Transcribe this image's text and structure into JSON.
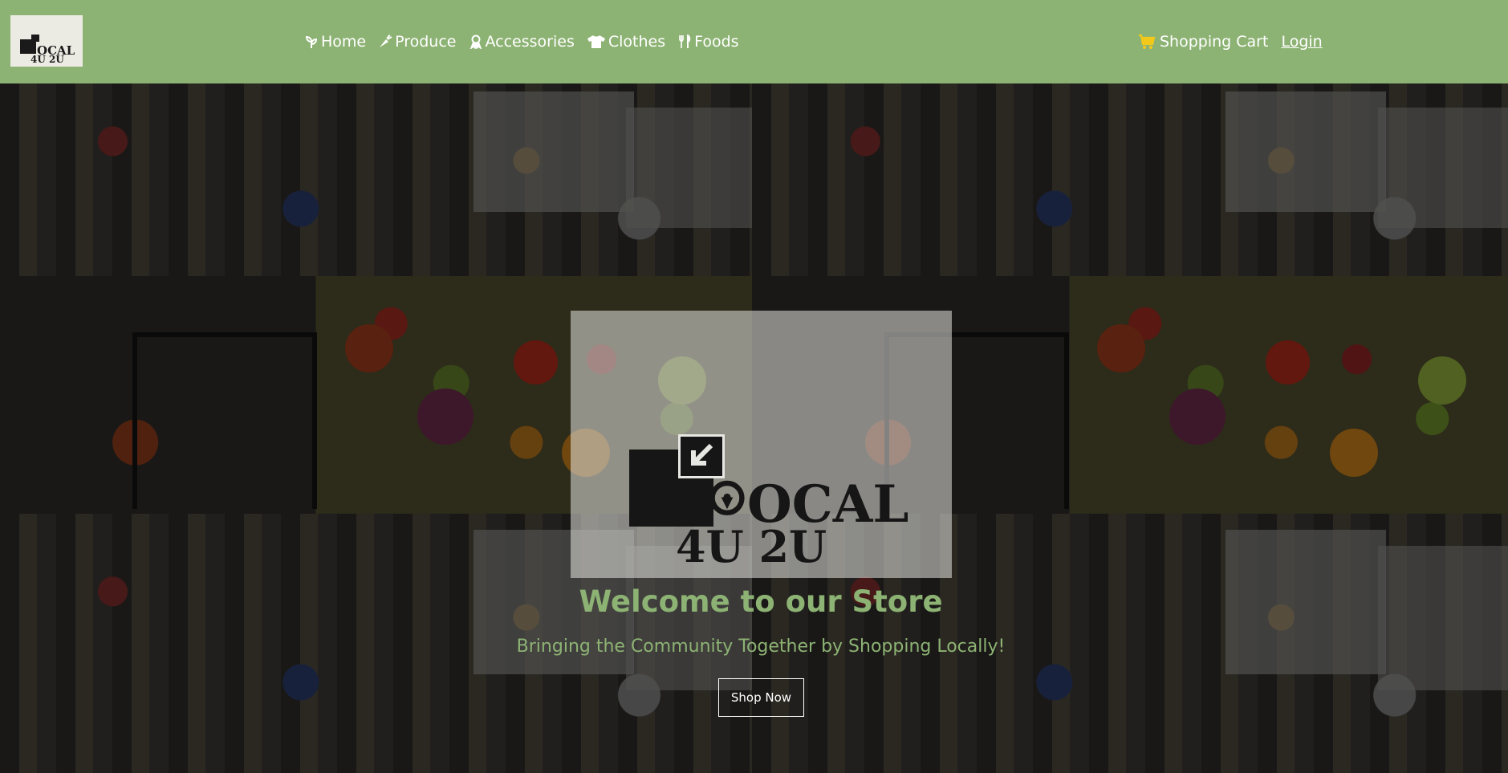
{
  "brand": {
    "logo_line1": "OCAL",
    "logo_line2": "4U 2U"
  },
  "nav": {
    "items": [
      {
        "label": "Home",
        "icon": "sprout-icon"
      },
      {
        "label": "Produce",
        "icon": "carrot-icon"
      },
      {
        "label": "Accessories",
        "icon": "ribbon-icon"
      },
      {
        "label": "Clothes",
        "icon": "shirt-icon"
      },
      {
        "label": "Foods",
        "icon": "utensils-icon"
      }
    ],
    "cart_label": "Shopping Cart",
    "cart_icon": "shopping-cart-icon",
    "login_label": "Login"
  },
  "hero": {
    "title": "Welcome to our Store",
    "subtitle": "Bringing the Community Together by Shopping Locally!",
    "cta_label": "Shop Now"
  },
  "colors": {
    "nav_bg": "#8db374",
    "accent_text": "#8db374",
    "cart_icon": "#f2c81a",
    "logo_bg": "#ecebe3",
    "ink": "#1a1a1a"
  }
}
